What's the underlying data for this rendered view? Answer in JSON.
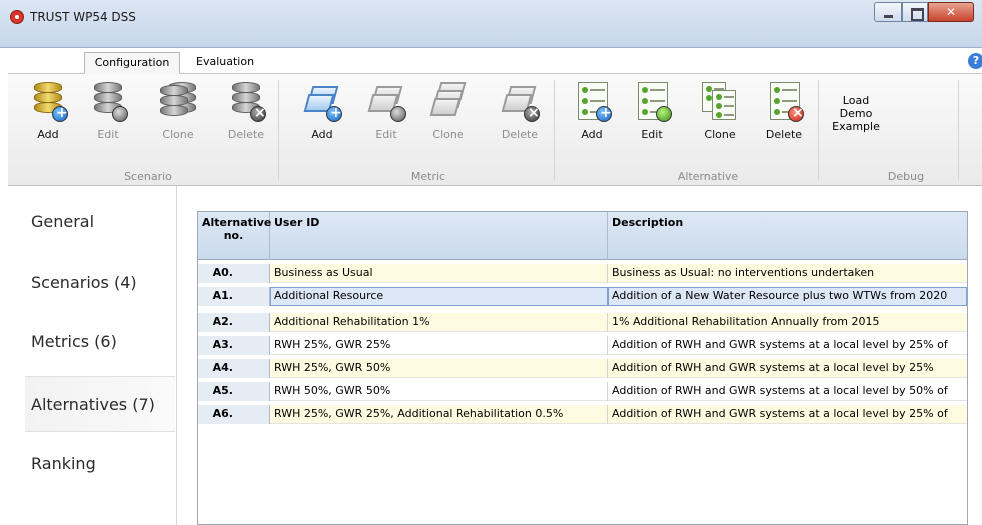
{
  "window": {
    "title": "TRUST WP54 DSS"
  },
  "tabs": {
    "configuration": "Configuration",
    "evaluation": "Evaluation"
  },
  "ribbon": {
    "scenario": {
      "group": "Scenario",
      "add": "Add",
      "edit": "Edit",
      "clone": "Clone",
      "delete": "Delete"
    },
    "metric": {
      "group": "Metric",
      "add": "Add",
      "edit": "Edit",
      "clone": "Clone",
      "delete": "Delete"
    },
    "alternative": {
      "group": "Alternative",
      "add": "Add",
      "edit": "Edit",
      "clone": "Clone",
      "delete": "Delete"
    },
    "debug": {
      "group": "Debug",
      "load_demo_line1": "Load",
      "load_demo_line2": "Demo",
      "load_demo_line3": "Example"
    }
  },
  "nav": {
    "general": "General",
    "scenarios": "Scenarios (4)",
    "metrics": "Metrics (6)",
    "alternatives": "Alternatives (7)",
    "ranking": "Ranking"
  },
  "grid": {
    "headers": {
      "alt_no_line1": "Alternative",
      "alt_no_line2": "no.",
      "user_id": "User ID",
      "description": "Description"
    },
    "rows": [
      {
        "id": "A0.",
        "user_id": "Business as Usual",
        "description": "Business as Usual: no interventions undertaken"
      },
      {
        "id": "A1.",
        "user_id": "Additional Resource",
        "description": "Addition of a New Water Resource plus two WTWs from 2020"
      },
      {
        "id": "A2.",
        "user_id": "Additional Rehabilitation 1%",
        "description": "1% Additional Rehabilitation Annually from 2015"
      },
      {
        "id": "A3.",
        "user_id": "RWH 25%, GWR 25%",
        "description": "Addition of RWH and GWR systems at a local level by 25% of"
      },
      {
        "id": "A4.",
        "user_id": "RWH 25%, GWR 50%",
        "description": "Addition of RWH and GWR systems at a local level by 25%"
      },
      {
        "id": "A5.",
        "user_id": "RWH 50%, GWR 50%",
        "description": "Addition of RWH and GWR systems at a local level by 50% of"
      },
      {
        "id": "A6.",
        "user_id": "RWH 25%, GWR 25%, Additional Rehabilitation 0.5%",
        "description": "Addition of RWH and GWR systems at a local level by 25% of"
      }
    ]
  }
}
